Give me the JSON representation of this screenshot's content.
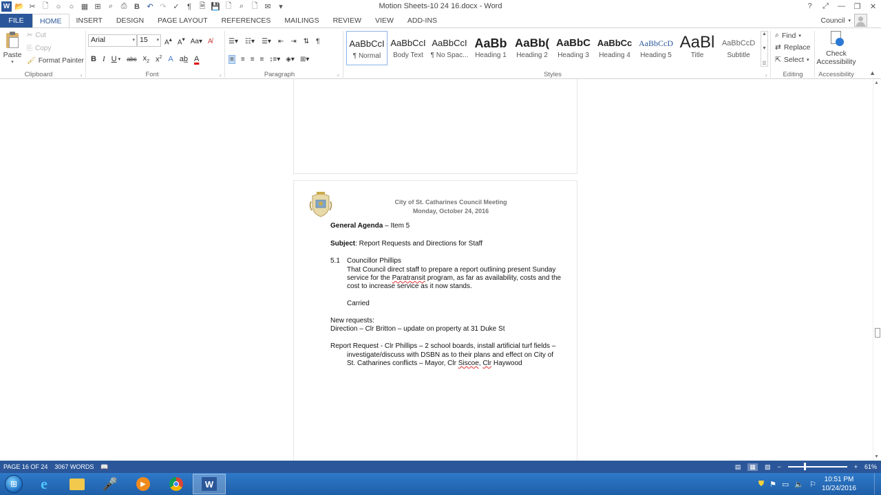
{
  "window": {
    "title": "Motion Sheets-10 24 16.docx - Word",
    "controls": [
      "?",
      "⤢",
      "—",
      "❐",
      "✕"
    ]
  },
  "tabs": [
    "FILE",
    "HOME",
    "INSERT",
    "DESIGN",
    "PAGE LAYOUT",
    "REFERENCES",
    "MAILINGS",
    "REVIEW",
    "VIEW",
    "ADD-INS"
  ],
  "account": {
    "name": "Council"
  },
  "ribbon": {
    "clipboard": {
      "paste": "Paste",
      "cut": "Cut",
      "copy": "Copy",
      "format_painter": "Format Painter",
      "label": "Clipboard"
    },
    "font": {
      "name": "Arial",
      "size": "15",
      "label": "Font"
    },
    "paragraph": {
      "label": "Paragraph"
    },
    "styles": {
      "label": "Styles",
      "items": [
        {
          "sample": "AaBbCcI",
          "name": "¶ Normal"
        },
        {
          "sample": "AaBbCcI",
          "name": "Body Text"
        },
        {
          "sample": "AaBbCcI",
          "name": "¶ No Spac..."
        },
        {
          "sample": "AaBb",
          "name": "Heading 1"
        },
        {
          "sample": "AaBb(",
          "name": "Heading 2"
        },
        {
          "sample": "AaBbC",
          "name": "Heading 3"
        },
        {
          "sample": "AaBbCc",
          "name": "Heading 4"
        },
        {
          "sample": "AaBbCcD",
          "name": "Heading 5"
        },
        {
          "sample": "AaBl",
          "name": "Title"
        },
        {
          "sample": "AaBbCcD",
          "name": "Subtitle"
        }
      ]
    },
    "editing": {
      "find": "Find",
      "replace": "Replace",
      "select": "Select",
      "label": "Editing"
    },
    "accessibility": {
      "check_line1": "Check",
      "check_line2": "Accessibility",
      "label": "Accessibility"
    }
  },
  "document": {
    "header_line1": "City of St. Catharines Council Meeting",
    "header_line2": "Monday, October 24, 2016",
    "agenda_bold": "General Agenda",
    "agenda_rest": " – Item 5",
    "subject_bold": "Subject",
    "subject_rest": ": Report Requests and Directions for Staff",
    "item_num": "5.1",
    "item_title": "Councillor Phillips",
    "item_l1": "That Council direct staff to prepare a report outlining present Sunday",
    "item_l2a": "service for the ",
    "item_l2b": "Paratransit",
    "item_l2c": " program, as far as availability, costs and the",
    "item_l3": "cost to increase service as it now stands.",
    "carried": "Carried",
    "new_requests": "New requests:",
    "direction": "Direction – Clr Britton – update on property at 31 Duke St",
    "report_l1": "Report Request - Clr Phillips – 2 school boards, install artificial turf fields –",
    "report_l2": "investigate/discuss with DSBN as to their plans and effect on City of",
    "report_l3a": "St. Catharines conflicts – Mayor, Clr ",
    "report_l3b": "Siscoe",
    "report_l3c": ", ",
    "report_l3d": "Clr",
    "report_l3e": " Haywood"
  },
  "status": {
    "page": "PAGE 16 OF 24",
    "words": "3067 WORDS",
    "zoom": "61%",
    "zoom_fraction": 0.61
  },
  "taskbar": {
    "time": "10:51 PM",
    "date": "10/24/2016"
  }
}
